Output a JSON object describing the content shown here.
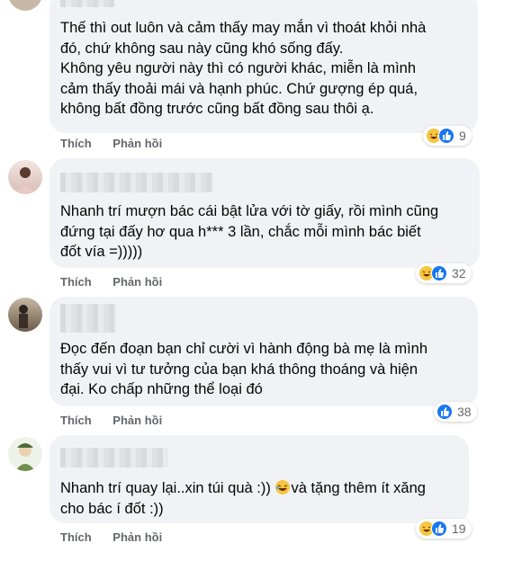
{
  "actions": {
    "like": "Thích",
    "reply": "Phản hồi"
  },
  "comments": [
    {
      "text": "Thế thì out luôn và cảm thấy may mắn vì thoát khỏi nhà\nđó, chứ không sau này cũng khó sống đấy.\nKhông yêu người này thì có người khác, miễn là mình\ncảm thấy thoải mái và hạnh phúc. Chứ gượng ép quá,\nkhông bất đồng trước cũng bất đồng sau thôi ạ.",
      "reaction_count": "9",
      "reactions": [
        "haha",
        "like"
      ]
    },
    {
      "text": "Nhanh trí mượn bác cái bật lửa với tờ giấy, rồi mình cũng\nđứng tại đấy hơ qua h*** 3 lần, chắc mỗi mình bác biết\nđốt vía =)))))",
      "reaction_count": "32",
      "reactions": [
        "haha",
        "like"
      ]
    },
    {
      "text": "Đọc đến đoạn bạn chỉ cười vì hành động bà mẹ là mình\nthấy vui vì tư tưởng của bạn khá thông thoáng và hiện\nđại. Ko chấp những thể loại đó",
      "reaction_count": "38",
      "reactions": [
        "like"
      ]
    },
    {
      "text_line1_a": "Nhanh trí quay lại..xin túi quà :)) ",
      "text_line1_b": "và tặng thêm ít xăng",
      "text_line2": "cho bác í đốt :))",
      "reaction_count": "19",
      "reactions": [
        "haha",
        "like"
      ]
    }
  ],
  "colors": {
    "bubble": "#f0f2f5",
    "like_blue": "#1877f2",
    "haha_yellow": "#f7c540",
    "meta_gray": "#65676b"
  }
}
